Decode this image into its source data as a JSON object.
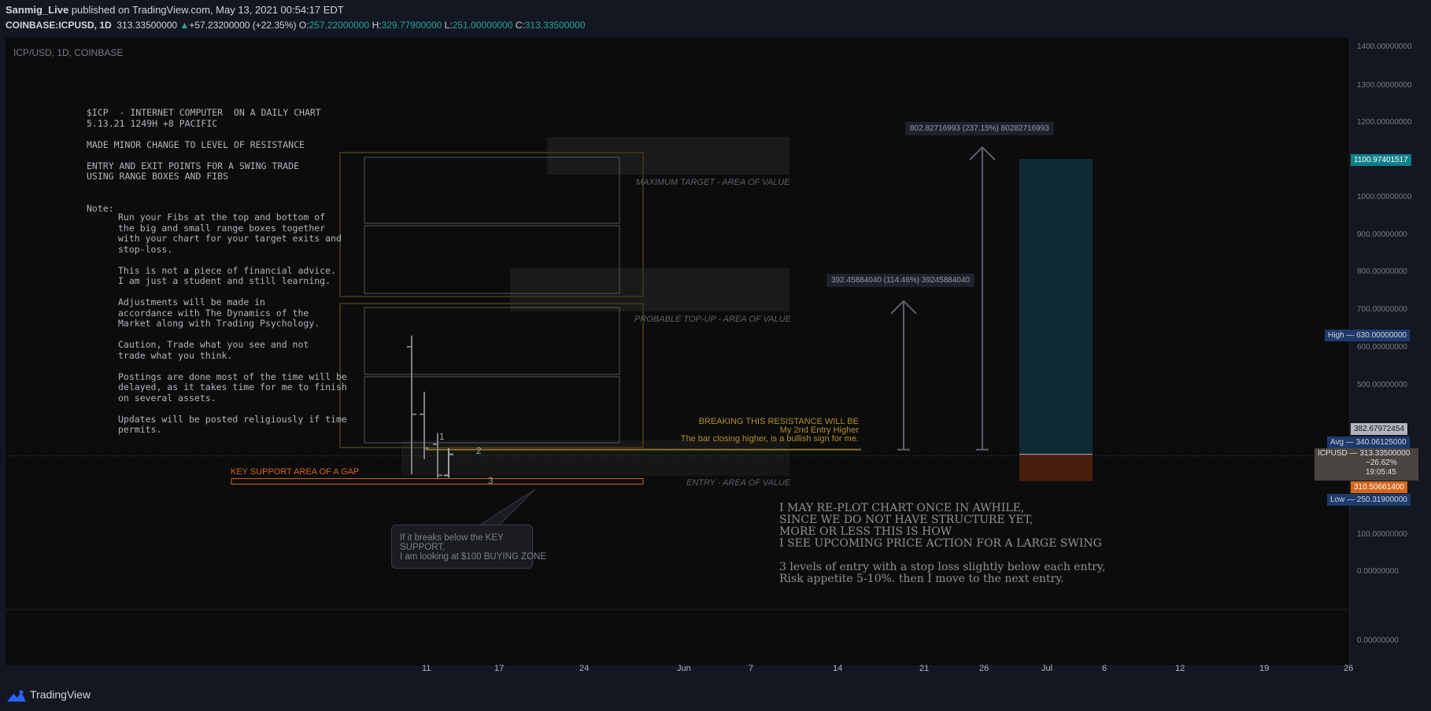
{
  "header": {
    "author": "Sanmig_Live",
    "published_text": "published on TradingView.com, May 13, 2021 00:54:17 EDT",
    "symbol": "COINBASE:ICPUSD, 1D",
    "last": "313.33500000",
    "change": "+57.23200000 (+22.35%)",
    "o_label": "O:",
    "o_value": "257.22000000",
    "h_label": "H:",
    "h_value": "329.77900000",
    "l_label": "L:",
    "l_value": "251.00000000",
    "c_label": "C:",
    "c_value": "313.33500000"
  },
  "chart_title": "ICP/USD, 1D, COINBASE",
  "notes": {
    "intro": "$ICP  - INTERNET COMPUTER  ON A DAILY CHART\n5.13.21 1249H +8 PACIFIC\n\nMADE MINOR CHANGE TO LEVEL OF RESISTANCE\n\nENTRY AND EXIT POINTS FOR A SWING TRADE\nUSING RANGE BOXES AND FIBS\n\n\nNote:",
    "body": "Run your Fibs at the top and bottom of\nthe big and small range boxes together\nwith your chart for your target exits and\nstop-loss.\n\nThis is not a piece of financial advice.\nI am just a student and still learning.\n\nAdjustments will be made in\naccordance with The Dynamics of the\nMarket along with Trading Psychology.\n\nCaution, Trade what you see and not\ntrade what you think.\n\nPostings are done most of the time will be\ndelayed, as it takes time for me to finish\non several assets.\n\nUpdates will be posted religiously if time\npermits."
  },
  "zones": {
    "max_target": "MAXIMUM TARGET - AREA OF VALUE",
    "probable_topup": "PROBABLE TOP-UP - AREA OF VALUE",
    "entry": "ENTRY - AREA OF VALUE",
    "key_support": "KEY SUPPORT AREA OF A GAP"
  },
  "entry_marks": [
    "1",
    "2",
    "3"
  ],
  "resistance_text": {
    "line1": "BREAKING THIS RESISTANCE WILL BE",
    "line2": "My 2nd Entry Higher",
    "line3": "The bar closing higher, is a bullish sign for me."
  },
  "callout": "If it breaks below the KEY\nSUPPORT,\nI am looking at $100 BUYING ZONE",
  "big_note": "I MAY RE-PLOT CHART ONCE IN AWHILE,\nSINCE WE DO NOT HAVE STRUCTURE YET,\nMORE OR LESS THIS IS HOW\nI SEE UPCOMING PRICE ACTION FOR A LARGE SWING\n\n3 levels of entry with a stop loss slightly below each entry,\nRisk appetite 5-10%. then I move to the next entry.",
  "measures": {
    "big": "802.82716993 (237.15%) 80282716993",
    "small": "392.45884040 (114.46%) 39245884040"
  },
  "price_axis": {
    "ticks": [
      "1400.00000000",
      "1300.00000000",
      "1200.00000000",
      "1000.00000000",
      "900.00000000",
      "800.00000000",
      "700.00000000",
      "600.00000000",
      "500.00000000",
      "100.00000000",
      "0.00000000",
      "0.00000000"
    ],
    "target": "1100.97401517",
    "high": "High  —  630.00000000",
    "tag_382": "382.67972454",
    "avg": "Avg  —  340.06125000",
    "icpusd": "ICPUSD  —  313.33500000",
    "pct": "−26.62%",
    "countdown": "19:05:45",
    "stop": "310.50661400",
    "low": "Low  —  250.31900000"
  },
  "x_axis": [
    "11",
    "17",
    "24",
    "Jun",
    "7",
    "14",
    "21",
    "26",
    "Jul",
    "6",
    "12",
    "19",
    "26"
  ],
  "footer": {
    "brand": "TradingView"
  },
  "colors": {
    "background": "#131722",
    "chart_bg": "#0c0c0c",
    "up": "#26a69a",
    "target_zone": "#0f2a33",
    "stop_zone": "#4a1e0d",
    "yellow": "#b29028",
    "orange": "#d4651c"
  },
  "chart_data": {
    "type": "candlestick",
    "title": "ICP/USD, 1D, COINBASE",
    "x": [
      "2021-05-10",
      "2021-05-11",
      "2021-05-12",
      "2021-05-13"
    ],
    "ohlc": [
      {
        "open": 600,
        "high": 630,
        "low": 260,
        "close": 420
      },
      {
        "open": 420,
        "high": 480,
        "low": 300,
        "close": 330
      },
      {
        "open": 340,
        "high": 370,
        "low": 250.319,
        "close": 257.22
      },
      {
        "open": 257.22,
        "high": 329.779,
        "low": 251.0,
        "close": 313.335
      }
    ],
    "levels": {
      "resistance": 330,
      "key_support": 240,
      "long_entry": 313.335,
      "long_stop": 250.319,
      "long_target": 1100.97401517,
      "target_1_from": 330,
      "target_1": 722,
      "target_2_from": 330,
      "target_2": 1132
    },
    "ylim": [
      0,
      1400
    ],
    "xlabel": "",
    "ylabel": ""
  }
}
